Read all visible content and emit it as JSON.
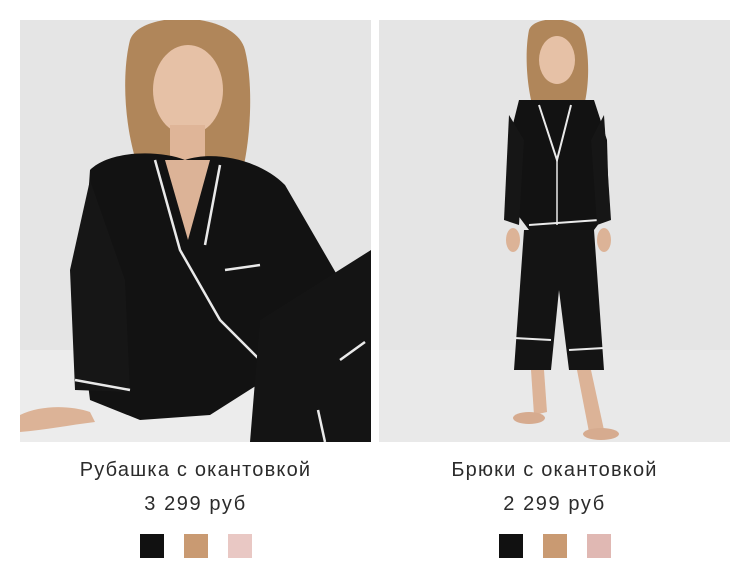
{
  "products": [
    {
      "name": "Рубашка с окантовкой",
      "price": "3 299 руб",
      "swatches": [
        {
          "color": "#111111",
          "icon": "swatch-black"
        },
        {
          "color": "#c99a72",
          "icon": "swatch-camel"
        },
        {
          "color": "#e9c8c4",
          "icon": "swatch-pink"
        }
      ]
    },
    {
      "name": "Брюки с окантовкой",
      "price": "2 299 руб",
      "swatches": [
        {
          "color": "#111111",
          "icon": "swatch-black"
        },
        {
          "color": "#c99a72",
          "icon": "swatch-camel"
        },
        {
          "color": "#e0b8b3",
          "icon": "swatch-pink"
        }
      ]
    }
  ]
}
